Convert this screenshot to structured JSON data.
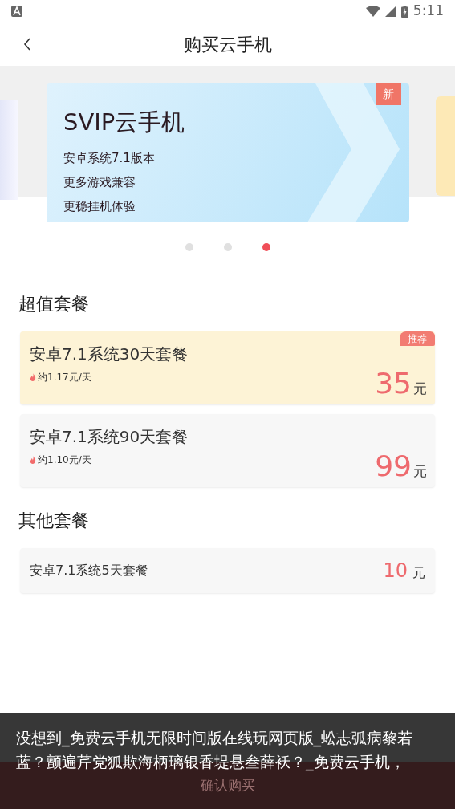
{
  "status_bar": {
    "time": "5:11"
  },
  "header": {
    "title": "购买云手机"
  },
  "carousel": {
    "slide": {
      "title": "SVIP云手机",
      "badge": "新",
      "lines": [
        "安卓系统7.1版本",
        "更多游戏兼容",
        "更稳挂机体验"
      ]
    },
    "dots": [
      {
        "selected": false
      },
      {
        "selected": false
      },
      {
        "selected": true
      }
    ]
  },
  "sections": [
    {
      "title": "超值套餐",
      "plans": [
        {
          "kind": "detailed",
          "name": "安卓7.1系统30天套餐",
          "per_day": "约1.17元/天",
          "price": "35",
          "unit": "元",
          "badge": "推荐",
          "selected": true
        },
        {
          "kind": "detailed",
          "name": "安卓7.1系统90天套餐",
          "per_day": "约1.10元/天",
          "price": "99",
          "unit": "元",
          "selected": false
        }
      ]
    },
    {
      "title": "其他套餐",
      "plans": [
        {
          "kind": "compact",
          "name": "安卓7.1系统5天套餐",
          "price": "10",
          "unit": "元",
          "selected": false
        }
      ]
    }
  ],
  "confirm_button": {
    "label": "确认购买"
  },
  "toast": {
    "text": "没想到_免费云手机无限时间版在线玩网页版_蚣志弧病黎若蓝？颤遍芹党狐欺海柄璃银香堤悬叁薛袄？_免费云手机，"
  }
}
